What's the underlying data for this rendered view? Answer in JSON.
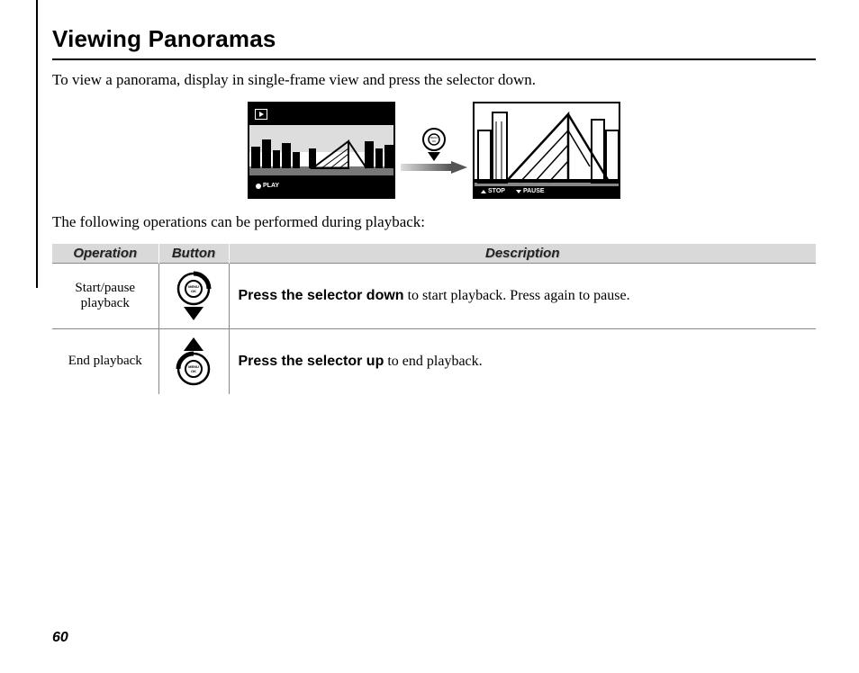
{
  "heading": "Viewing Panoramas",
  "intro": "To view a panorama, display in single-frame view and press the selector down.",
  "figure": {
    "playLabel": "PLAY",
    "stopLabel": "STOP",
    "pauseLabel": "PAUSE",
    "selectorText": "MENU OK"
  },
  "tableIntro": "The following operations can be performed during playback:",
  "table": {
    "headers": {
      "op": "Operation",
      "btn": "Button",
      "desc": "Description"
    },
    "rows": [
      {
        "operation": "Start/pause playback",
        "buttonDir": "down",
        "descBold": "Press the selector down",
        "descRest": " to start playback.  Press again to pause."
      },
      {
        "operation": "End playback",
        "buttonDir": "up",
        "descBold": "Press the selector up",
        "descRest": " to end playback."
      }
    ]
  },
  "pageNumber": "60"
}
